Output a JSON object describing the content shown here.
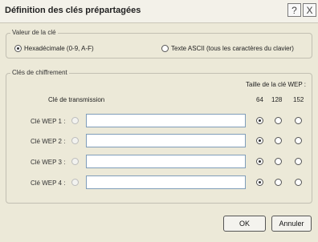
{
  "window": {
    "title": "Définition des clés prépartagées",
    "help_glyph": "?",
    "close_glyph": "X"
  },
  "key_value": {
    "legend": "Valeur de la clé",
    "options": [
      {
        "label": "Hexadécimale (0-9, A-F)",
        "selected": true
      },
      {
        "label": "Texte ASCII (tous les caractères du clavier)",
        "selected": false
      }
    ]
  },
  "encryption_keys": {
    "legend": "Clés de chiffrement",
    "size_header": "Taille de la clé WEP :",
    "transmission_header": "Clé de transmission",
    "sizes": [
      "64",
      "128",
      "152"
    ],
    "rows": [
      {
        "label": "Clé WEP 1 :",
        "value": "",
        "size_selected": "64"
      },
      {
        "label": "Clé WEP 2 :",
        "value": "",
        "size_selected": "64"
      },
      {
        "label": "Clé WEP 3 :",
        "value": "",
        "size_selected": "64"
      },
      {
        "label": "Clé WEP 4 :",
        "value": "",
        "size_selected": "64"
      }
    ]
  },
  "buttons": {
    "ok": "OK",
    "cancel": "Annuler"
  }
}
